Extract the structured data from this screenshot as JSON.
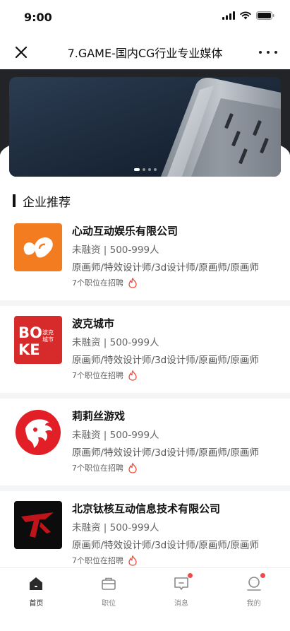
{
  "status_bar": {
    "time": "9:00"
  },
  "nav": {
    "title": "7.GAME-国内CG行业专业媒体"
  },
  "section": {
    "title": "企业推荐"
  },
  "companies": [
    {
      "name": "心动互动娱乐有限公司",
      "meta": "未融资 | 500-999人",
      "roles": "原画师/特效设计师/3d设计师/原画师/原画师",
      "jobs": "7个职位在招聘",
      "logo_color": "#f47c20"
    },
    {
      "name": "波克城市",
      "meta": "未融资 | 500-999人",
      "roles": "原画师/特效设计师/3d设计师/原画师/原画师",
      "jobs": "7个职位在招聘",
      "logo_color": "#d72b2b"
    },
    {
      "name": "莉莉丝游戏",
      "meta": "未融资 | 500-999人",
      "roles": "原画师/特效设计师/3d设计师/原画师/原画师",
      "jobs": "7个职位在招聘",
      "logo_color": "#e21f26"
    },
    {
      "name": "北京钛核互动信息技术有限公司",
      "meta": "未融资 | 500-999人",
      "roles": "原画师/特效设计师/3d设计师/原画师/原画师",
      "jobs": "7个职位在招聘",
      "logo_color": "#0c0c0c"
    }
  ],
  "logos": {
    "boke_line1": "BO",
    "boke_line2": "KE",
    "boke_small1": "波克",
    "boke_small2": "城市"
  },
  "tabs": [
    {
      "label": "首页",
      "icon": "home-icon",
      "active": true
    },
    {
      "label": "职位",
      "icon": "briefcase-icon",
      "active": false
    },
    {
      "label": "消息",
      "icon": "message-icon",
      "active": false,
      "badge": true
    },
    {
      "label": "我的",
      "icon": "profile-icon",
      "active": false,
      "badge": true
    }
  ],
  "colors": {
    "accent": "#f04a4a",
    "flame": "#e74c3c"
  }
}
